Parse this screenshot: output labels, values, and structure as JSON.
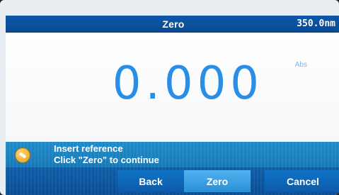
{
  "header": {
    "title": "Zero",
    "wavelength": "350.0nm"
  },
  "readout": {
    "value": "0.000",
    "unit": "Abs"
  },
  "message": {
    "line1": "Insert reference",
    "line2": "Click \"Zero\" to continue",
    "icon": "cuvette-icon"
  },
  "buttons": {
    "back": "Back",
    "zero": "Zero",
    "cancel": "Cancel"
  },
  "colors": {
    "header_blue": "#0d58a8",
    "readout_blue": "#2a8ee6",
    "message_blue": "#1f8ac9",
    "active_button": "#4fb3f0",
    "icon_orange": "#e79c14"
  }
}
